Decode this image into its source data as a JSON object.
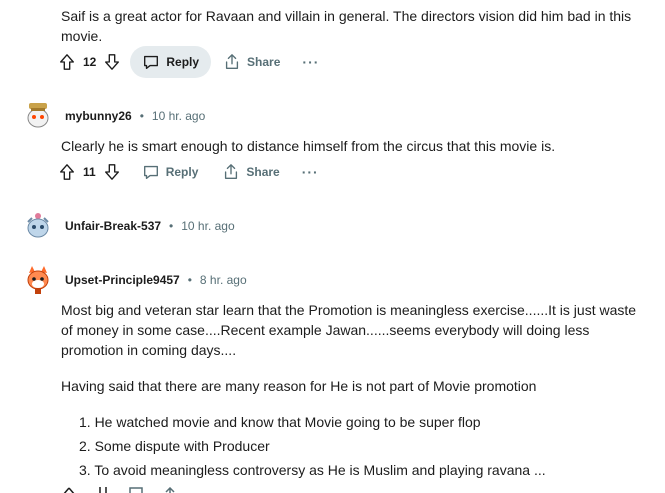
{
  "comments": [
    {
      "text": "Saif is a great actor for Ravaan and villain in general. The directors vision did him bad in this movie.",
      "score": "12",
      "reply_label": "Reply",
      "share_label": "Share",
      "more_label": "···"
    },
    {
      "username": "mybunny26",
      "time": "10 hr. ago",
      "text": "Clearly he is smart enough to distance himself from the circus that this movie is.",
      "score": "11",
      "reply_label": "Reply",
      "share_label": "Share",
      "more_label": "···"
    },
    {
      "username": "Unfair-Break-537",
      "time": "10 hr. ago"
    },
    {
      "username": "Upset-Principle9457",
      "time": "8 hr. ago",
      "paragraph1": "Most big and veteran star learn that the Promotion is meaningless exercise......It is just waste of money in some case....Recent example Jawan......seems everybody will doing less promotion in coming days....",
      "paragraph2": "Having said that there are many reason for He is not part of Movie promotion",
      "reasons": [
        "1. He watched movie and know that Movie going to be super flop",
        "2. Some dispute with Producer",
        "3. To avoid meaningless controversy as He is Muslim and playing ravana ..."
      ]
    }
  ],
  "separator": "•",
  "colors": {
    "text": "#1c1c1c",
    "meta": "#576f76",
    "active_pill": "#e5ebee"
  }
}
